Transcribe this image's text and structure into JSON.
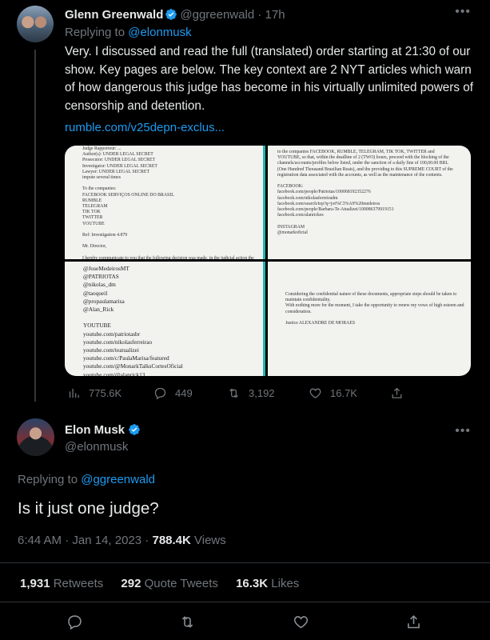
{
  "parent_tweet": {
    "author_name": "Glenn Greenwald",
    "handle": "@ggreenwald",
    "separator": "·",
    "time": "17h",
    "replying_prefix": "Replying to ",
    "replying_to": "@elonmusk",
    "text": "Very. I discussed and read the full (translated) order starting at 21:30 of our show. Key pages are below. The key context are 2 NYT articles which warn of how dangerous this judge has become in his virtually unlimited powers of censorship and detention.",
    "link": "rumble.com/v25depn-exclus...",
    "media": {
      "doc1": "Judge Rapporteur: ...\nAuthor(s): UNDER LEGAL SECRET\nProsecutor: UNDER LEGAL SECRET\nInvestigator: UNDER LEGAL SECRET\nLawyer: UNDER LEGAL SECRET\nimpute several times\n\nTo the companies:\nFACEBOOK SERVIÇOS ONLINE DO BRASIL\nRUMBLE\nTELEGRAM\nTIK TOK\nTWITTER\nYOUTUBE\n\nRef: Investigation 4.879\n\nMr. Director,\n\nI hereby communicate to you that the following decision was made, in the judicial action the",
      "doc2": "to the companies FACEBOOK, RUMBLE, TELEGRAM, TIK TOK, TWITTER and\nYOUTUBE, so that, within the deadline of 2 (TWO) hours, proceed with the blocking of the\nchannels/accounts/profiles below listed, under the sanction of a daily fine of 100,00.00 BRL\n(One Hundred Thousand Brazilian Reais), and the providing to this SUPREME COURT of the\nregistration data associated with the accounts, as well as the maintenance of the contents.\n\nFACEBOOK:\nfacebook.com/people/Patriotas/100068192352276\nfacebook.com/nikolasferreiradm\nfacebook.com/search/top?q=jot%C3%A9%20medeiros\nfacebook.com/people/Barbara-Te-Atualizei/100086379919151\nfacebook.com/alanrickes\n\nINSTAGRAM\n@monarkoficial",
      "doc3": "@JoseMedeirosMT\n@PATRIOTAS\n@nikolas_dm\n@taoqueil\n@propaulamarisa\n@Alan_Rick\n\nYOUTUBE\nyoutube.com/patriotasbr\nyoutube.com/nikolasferreirao\nyoutube.com/teatualizei\nyoutube.com/c/PaulaMarisa/featured\nyoutube.com/@MonarkTalksCortesOficial\nyoutube.com/@alanrick13",
      "doc4": "Considering the confidential nature of these documents, appropriate steps should be taken to\nmaintain confidentiality.\nWith nothing more for the moment, I take the opportunity to renew my vows of high esteem and\nconsideration.\n\nJustice ALEXANDRE DE MORAES"
    },
    "stats": {
      "views": "775.6K",
      "replies": "449",
      "retweets": "3,192",
      "likes": "16.7K"
    }
  },
  "main_tweet": {
    "author_name": "Elon Musk",
    "handle": "@elonmusk",
    "replying_prefix": "Replying to ",
    "replying_to": "@ggreenwald",
    "text": "Is it just one judge?",
    "time": "6:44 AM",
    "separator1": " · ",
    "date": "Jan 14, 2023",
    "separator2": " · ",
    "views_count": "788.4K",
    "views_label": " Views",
    "retweets_count": "1,931",
    "retweets_label": " Retweets",
    "quotes_count": "292",
    "quotes_label": " Quote Tweets",
    "likes_count": "16.3K",
    "likes_label": " Likes"
  },
  "icons": [
    "more-icon",
    "verified-icon",
    "views-icon",
    "reply-icon",
    "retweet-icon",
    "like-icon",
    "share-icon"
  ],
  "colors": {
    "accent": "#1d9bf0",
    "muted": "#71767b",
    "background": "#000000",
    "text": "#e7e9ea"
  }
}
